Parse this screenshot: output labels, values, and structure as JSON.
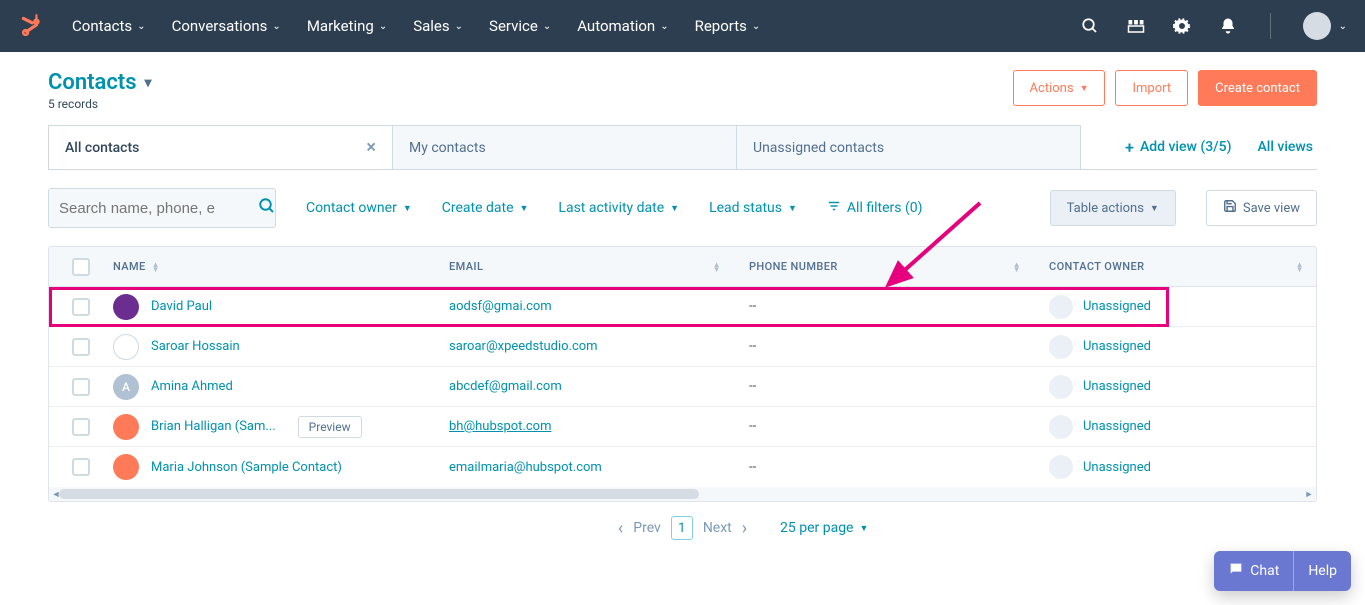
{
  "nav": [
    "Contacts",
    "Conversations",
    "Marketing",
    "Sales",
    "Service",
    "Automation",
    "Reports"
  ],
  "page": {
    "title": "Contacts",
    "record_count": "5 records"
  },
  "head_actions": {
    "actions": "Actions",
    "import": "Import",
    "create": "Create contact"
  },
  "tabs": {
    "active": "All contacts",
    "my": "My contacts",
    "unassigned": "Unassigned contacts",
    "add_view": "Add view (3/5)",
    "all_views": "All views"
  },
  "search_placeholder": "Search name, phone, e",
  "filters": {
    "owner": "Contact owner",
    "create": "Create date",
    "activity": "Last activity date",
    "lead": "Lead status",
    "all": "All filters (0)"
  },
  "actions": {
    "table": "Table actions",
    "save": "Save view"
  },
  "columns": {
    "name": "NAME",
    "email": "EMAIL",
    "phone": "PHONE NUMBER",
    "owner": "CONTACT OWNER"
  },
  "rows": [
    {
      "name": "David Paul",
      "email": "aodsf@gmai.com",
      "phone": "--",
      "owner": "Unassigned",
      "avatar_bg": "#6b2d90",
      "avatar_text": ""
    },
    {
      "name": "Saroar Hossain",
      "email": "saroar@xpeedstudio.com",
      "phone": "--",
      "owner": "Unassigned",
      "avatar_bg": "#ffffff",
      "avatar_text": ""
    },
    {
      "name": "Amina Ahmed",
      "email": "abcdef@gmail.com",
      "phone": "--",
      "owner": "Unassigned",
      "avatar_bg": "#b0c1d4",
      "avatar_text": "A"
    },
    {
      "name": "Brian Halligan (Sam...",
      "email": "bh@hubspot.com",
      "phone": "--",
      "owner": "Unassigned",
      "avatar_bg": "#ff7a59",
      "avatar_text": "",
      "preview": "Preview",
      "underline": true
    },
    {
      "name": "Maria Johnson (Sample Contact)",
      "email": "emailmaria@hubspot.com",
      "phone": "--",
      "owner": "Unassigned",
      "avatar_bg": "#ff7a59",
      "avatar_text": ""
    }
  ],
  "pager": {
    "prev": "Prev",
    "page": "1",
    "next": "Next",
    "per_page": "25 per page"
  },
  "widgets": {
    "chat": "Chat",
    "help": "Help"
  }
}
